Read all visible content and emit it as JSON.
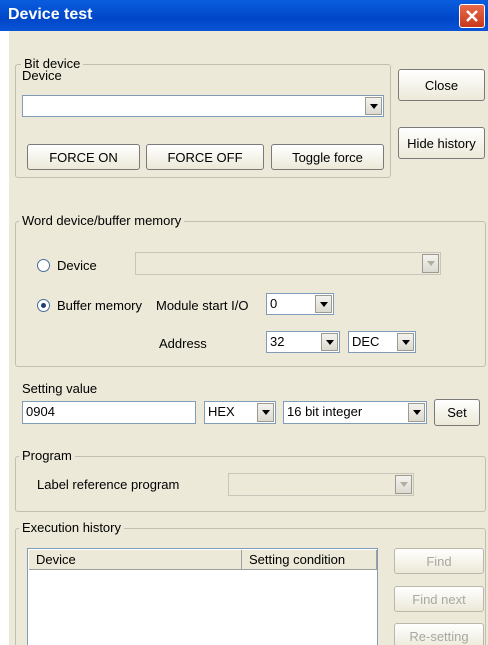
{
  "window": {
    "title": "Device test"
  },
  "bit_device": {
    "legend": "Bit device",
    "device_label": "Device",
    "device_value": "",
    "force_on": "FORCE ON",
    "force_off": "FORCE OFF",
    "toggle_force": "Toggle force"
  },
  "side_buttons": {
    "close": "Close",
    "hide_history": "Hide history"
  },
  "word_device": {
    "legend": "Word device/buffer memory",
    "device_radio": "Device",
    "device_value": "",
    "buffer_radio": "Buffer memory",
    "module_start_label": "Module start I/O",
    "module_start_value": "0",
    "address_label": "Address",
    "address_value": "32",
    "address_format": "DEC",
    "selected": "buffer_memory"
  },
  "setting": {
    "label": "Setting value",
    "value": "0904",
    "format": "HEX",
    "type": "16 bit integer",
    "set_button": "Set"
  },
  "program": {
    "legend": "Program",
    "label_ref": "Label reference program",
    "value": ""
  },
  "history": {
    "legend": "Execution history",
    "columns": [
      "Device",
      "Setting condition"
    ],
    "rows": [],
    "find": "Find",
    "find_next": "Find next",
    "resetting": "Re-setting"
  },
  "colors": {
    "titlebar": "#0047c8",
    "dialog_bg": "#ece9d8",
    "close_button": "#c8391a"
  }
}
